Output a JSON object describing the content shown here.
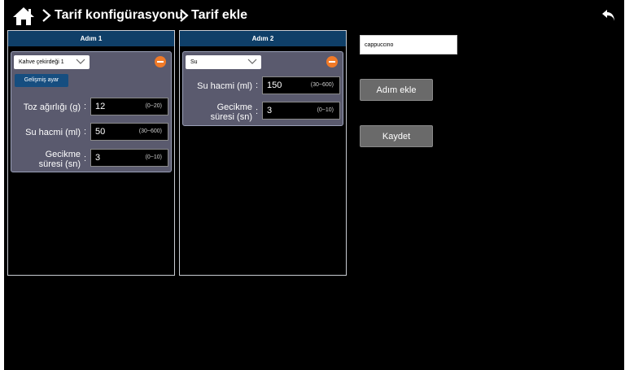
{
  "header": {
    "home_icon": "home-icon",
    "crumbs": [
      "Tarif konfigürasyonu",
      "Tarif ekle"
    ],
    "back_icon": "back-arrow-icon"
  },
  "steps": [
    {
      "title": "Adım 1",
      "ingredient": "Kahve çekirdeği 1",
      "advanced_label": "Gelişmiş ayar",
      "fields": [
        {
          "label": "Toz ağırlığı (g)",
          "value": "12",
          "range": "(0~20)"
        },
        {
          "label": "Su hacmi (ml)",
          "value": "50",
          "range": "(30~600)"
        },
        {
          "label": "Gecikme süresi (sn)",
          "value": "3",
          "range": "(0~10)"
        }
      ]
    },
    {
      "title": "Adım 2",
      "ingredient": "Su",
      "fields": [
        {
          "label": "Su hacmi (ml)",
          "value": "150",
          "range": "(30~600)"
        },
        {
          "label": "Gecikme süresi (sn)",
          "value": "3",
          "range": "(0~10)"
        }
      ]
    }
  ],
  "recipe_name": "cappuccino",
  "buttons": {
    "add_step": "Adım ekle",
    "save": "Kaydet"
  },
  "colors": {
    "background": "#000000",
    "step_header": "#0f3f68",
    "card": "#5a5a6e",
    "remove": "#f07a28",
    "button": "#6a6a6a"
  }
}
